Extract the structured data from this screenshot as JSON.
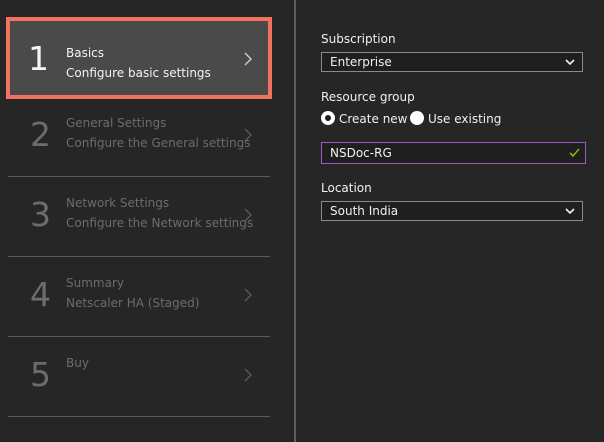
{
  "steps": [
    {
      "number": "1",
      "title": "Basics",
      "subtitle": "Configure basic settings",
      "active": true
    },
    {
      "number": "2",
      "title": "General Settings",
      "subtitle": "Configure the General settings",
      "active": false
    },
    {
      "number": "3",
      "title": "Network Settings",
      "subtitle": "Configure the Network settings",
      "active": false
    },
    {
      "number": "4",
      "title": "Summary",
      "subtitle": "Netscaler HA (Staged)",
      "active": false
    },
    {
      "number": "5",
      "title": "Buy",
      "subtitle": "",
      "active": false
    }
  ],
  "form": {
    "subscription": {
      "label": "Subscription",
      "value": "Enterprise"
    },
    "resource_group": {
      "label": "Resource group",
      "options": [
        {
          "label": "Create new",
          "selected": true
        },
        {
          "label": "Use existing",
          "selected": false
        }
      ],
      "value": "NSDoc-RG"
    },
    "location": {
      "label": "Location",
      "value": "South India"
    }
  },
  "colors": {
    "background": "#262626",
    "active_step_bg": "#4a4a4a",
    "active_step_border": "#f0735f",
    "inactive_text": "#6c6c6c",
    "text": "#f0f0f0",
    "input_focus_border": "#9a5cc6",
    "valid_check": "#7fba00"
  }
}
